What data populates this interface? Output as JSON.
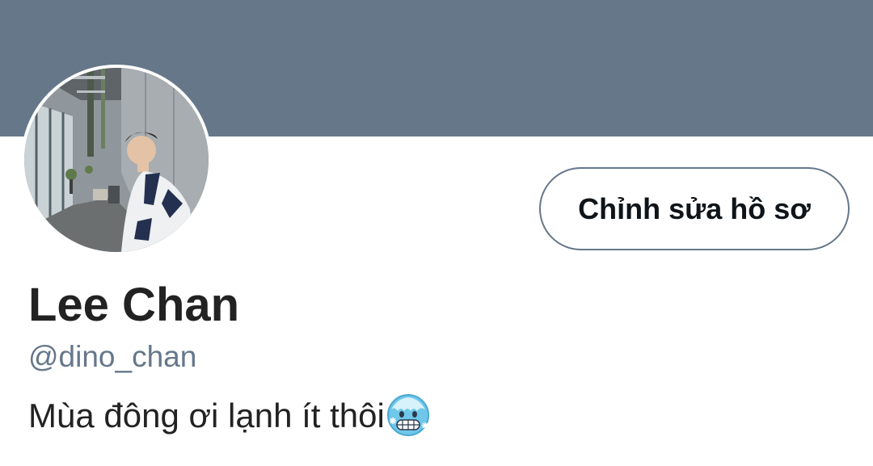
{
  "profile": {
    "display_name": "Lee Chan",
    "handle": "@dino_chan",
    "bio": "Mùa đông ơi lạnh ít thôi",
    "bio_emoji": "cold-face-emoji"
  },
  "actions": {
    "edit_profile_label": "Chỉnh sửa hồ sơ"
  },
  "colors": {
    "banner": "#66778a",
    "button_border": "#66778a",
    "handle_text": "#66778a",
    "primary_text": "#222222"
  }
}
